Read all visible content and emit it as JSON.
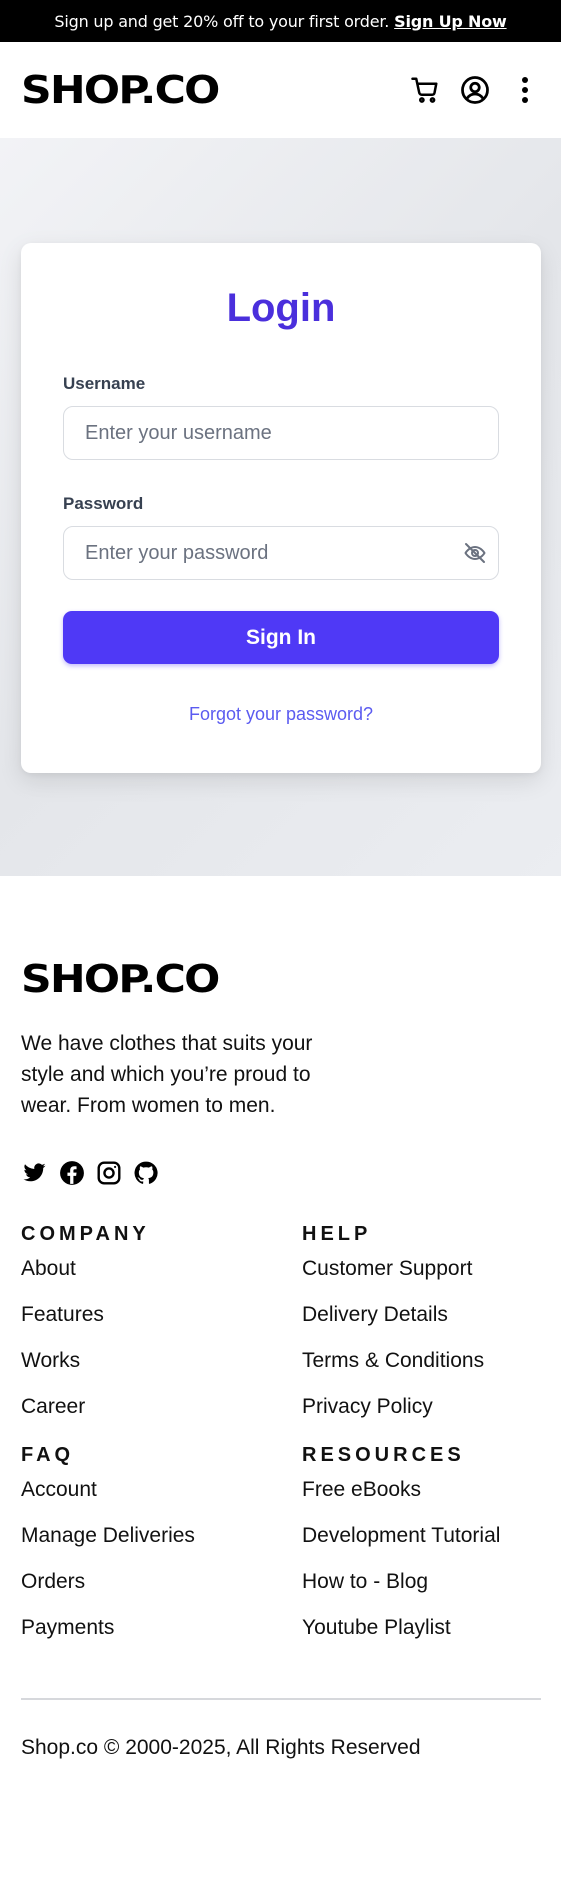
{
  "promo": {
    "text": "Sign up and get 20% off to your first order.",
    "link": "Sign Up Now"
  },
  "header": {
    "logo": "SHOP.CO",
    "icons": [
      "cart-icon",
      "user-circle-icon",
      "more-vertical-icon"
    ]
  },
  "login": {
    "title": "Login",
    "username_label": "Username",
    "username_placeholder": "Enter your username",
    "password_label": "Password",
    "password_placeholder": "Enter your password",
    "toggle_icon": "eye-off-icon",
    "submit_label": "Sign In",
    "forgot_label": "Forgot your password?"
  },
  "footer": {
    "logo": "SHOP.CO",
    "tagline": "We have clothes that suits your style and which you’re proud to wear. From women to men.",
    "socials": [
      "twitter-icon",
      "facebook-icon",
      "instagram-icon",
      "github-icon"
    ],
    "company": {
      "title": "COMPANY",
      "items": [
        "About",
        "Features",
        "Works",
        "Career"
      ]
    },
    "help": {
      "title": "HELP",
      "items": [
        "Customer Support",
        "Delivery Details",
        "Terms & Conditions",
        "Privacy Policy"
      ]
    },
    "faq": {
      "title": "FAQ",
      "items": [
        "Account",
        "Manage Deliveries",
        "Orders",
        "Payments"
      ]
    },
    "resources": {
      "title": "RESOURCES",
      "items": [
        "Free eBooks",
        "Development Tutorial",
        "How to - Blog",
        "Youtube Playlist"
      ]
    },
    "copyright": "Shop.co © 2000-2025, All Rights Reserved"
  },
  "colors": {
    "accent": "#4f39f6",
    "title": "#4a2fdc",
    "link": "#5b5bf0",
    "promo_bg": "#000000"
  }
}
